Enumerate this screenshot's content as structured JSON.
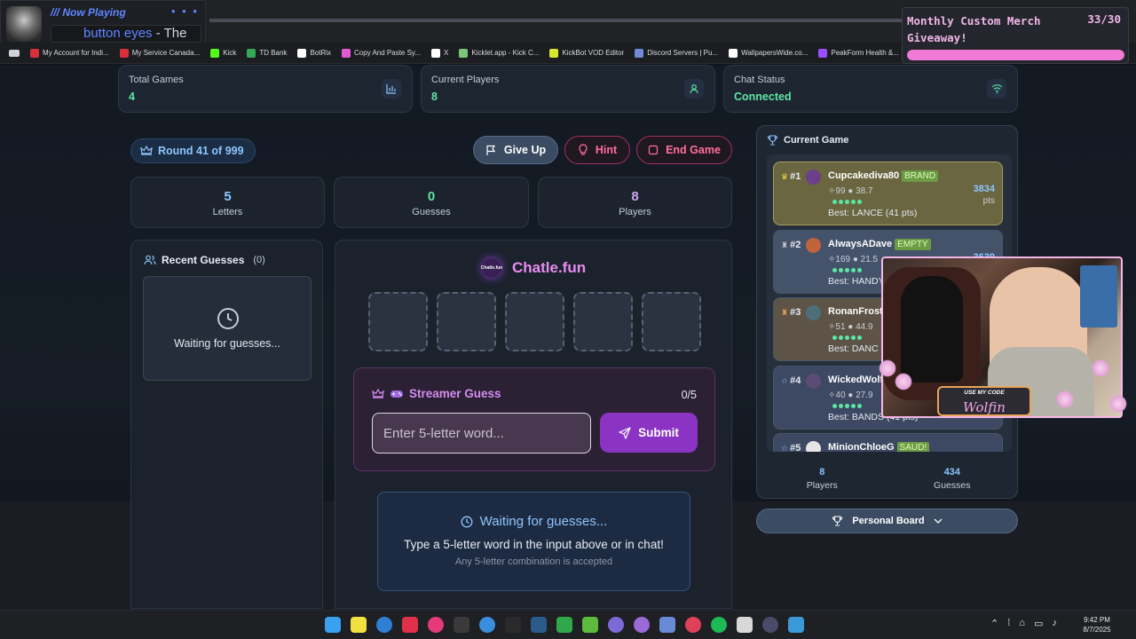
{
  "now_playing": {
    "label": "/// Now Playing",
    "dots": "• • •",
    "song_highlight": "button eyes",
    "song_rest": " - The"
  },
  "bookmarks": [
    {
      "label": "My Account for Indi...",
      "color": "#d6313a"
    },
    {
      "label": "My Service Canada...",
      "color": "#d6313a"
    },
    {
      "label": "Kick",
      "color": "#53fc18"
    },
    {
      "label": "TD Bank",
      "color": "#34a853"
    },
    {
      "label": "BotRix",
      "color": "#ffffff"
    },
    {
      "label": "Copy And Paste Sy...",
      "color": "#e05bd3"
    },
    {
      "label": "X",
      "color": "#ffffff"
    },
    {
      "label": "Kicklet.app - Kick C...",
      "color": "#7bc67b"
    },
    {
      "label": "KickBot VOD Editor",
      "color": "#d8e62c"
    },
    {
      "label": "Discord Servers | Pu...",
      "color": "#7289da"
    },
    {
      "label": "WallpapersWide.co...",
      "color": "#ffffff"
    },
    {
      "label": "PeakForm Health &...",
      "color": "#9b4dff"
    }
  ],
  "merch": {
    "title": "Monthly Custom Merch Giveaway!",
    "count": "33/30",
    "progress": 1.0
  },
  "stats": {
    "total_games": {
      "label": "Total Games",
      "value": "4"
    },
    "current_players": {
      "label": "Current Players",
      "value": "8"
    },
    "chat_status": {
      "label": "Chat Status",
      "value": "Connected"
    }
  },
  "round": "Round 41 of 999",
  "buttons": {
    "give_up": "Give Up",
    "hint": "Hint",
    "end_game": "End Game"
  },
  "metrics": [
    {
      "num": "5",
      "cap": "Letters"
    },
    {
      "num": "0",
      "cap": "Guesses"
    },
    {
      "num": "8",
      "cap": "Players"
    }
  ],
  "recent": {
    "title": "Recent Guesses",
    "count": "(0)",
    "waiting": "Waiting for guesses..."
  },
  "game": {
    "brand": "Chatle.fun",
    "logo_text": "Chatle.fun",
    "streamer_guess": "Streamer Guess",
    "guess_count": "0/5",
    "input_placeholder": "Enter 5-letter word...",
    "submit": "Submit",
    "wait_title": "Waiting for guesses...",
    "wait_line1": "Type a 5-letter word in the input above or in chat!",
    "wait_line2": "Any 5-letter combination is accepted"
  },
  "leaderboard": {
    "title": "Current Game",
    "entries": [
      {
        "rank": "#1",
        "name": "Cupcakediva80",
        "tag": "BRAND",
        "stats": "✧99 ● 38.7",
        "best": "Best: LANCE (41 pts)",
        "points": "3834",
        "unit": "pts"
      },
      {
        "rank": "#2",
        "name": "AlwaysADave",
        "tag": "EMPTY",
        "stats": "✧169 ● 21.5",
        "best": "Best: HANDY",
        "points": "3639",
        "unit": ""
      },
      {
        "rank": "#3",
        "name": "RonanFrost",
        "tag": "",
        "stats": "✧51 ● 44.9",
        "best": "Best: DANC",
        "points": "",
        "unit": ""
      },
      {
        "rank": "#4",
        "name": "WickedWolf",
        "tag": "",
        "stats": "✧40 ● 27.9",
        "best": "Best: BANDS (41 pts)",
        "points": "",
        "unit": ""
      },
      {
        "rank": "#5",
        "name": "MinionChloeG",
        "tag": "SAUD!",
        "stats": "",
        "best": "",
        "points": "",
        "unit": ""
      }
    ],
    "footer": [
      {
        "num": "8",
        "cap": "Players"
      },
      {
        "num": "434",
        "cap": "Guesses"
      }
    ]
  },
  "personal_board": "Personal Board",
  "overlay": {
    "use_code": "USE MY CODE",
    "code": "Wolfin"
  },
  "clock": {
    "time": "9:42 PM",
    "date": "8/7/2025"
  },
  "colors": {
    "accent_blue": "#8ec5ff",
    "accent_green": "#5ee6a5",
    "accent_purple": "#8b34c3",
    "accent_pink": "#ff6f9a"
  }
}
